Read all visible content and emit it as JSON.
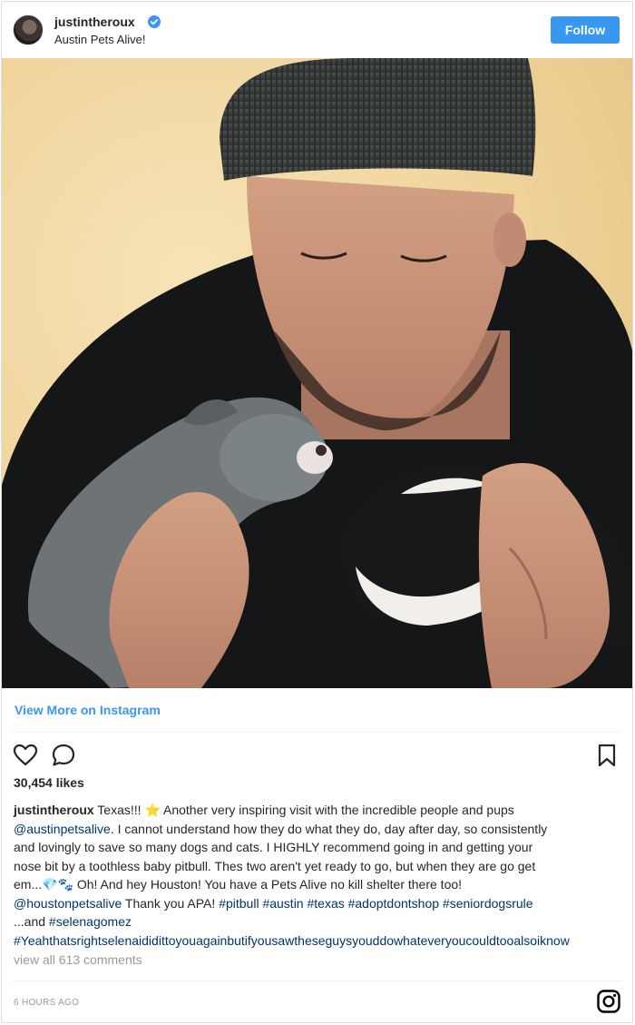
{
  "header": {
    "username": "justintheroux",
    "location": "Austin Pets Alive!",
    "follow_label": "Follow",
    "verified_icon": "verified-badge-icon",
    "accent_color": "#3897f0"
  },
  "post": {
    "view_more_label": "View More on Instagram",
    "likes": "30,454 likes",
    "caption": {
      "username": "justintheroux",
      "line1_text": " Texas!!! ⭐ Another very inspiring visit with the incredible people and pups",
      "line2_tag": "@austinpetsalive",
      "line2_text": ". I cannot understand how they do what they do, day after day, so consistently",
      "line3_text": "and lovingly to save so many dogs and cats. I HIGHLY recommend going in and getting your",
      "line4_text": "nose bit by a toothless baby pitbull. Thes two aren't yet ready to go, but when they are go get",
      "line5_text": "em...💎🐾 Oh! And hey Houston! You have a Pets Alive no kill shelter there too!",
      "line6_tag1": "@houstonpetsalive",
      "line6_text": " Thank you APA! ",
      "line6_tags": "#pitbull #austin #texas #adoptdontshop #seniordogsrule",
      "line7_text": "...and ",
      "line7_tag": "#selenagomez",
      "line8_tag": "#Yeahthatsrightselenaididittoyouagainbutifyousawtheseguysyouddowhateveryoucouldtooalsoiknow"
    },
    "comments_link": "view all 613 comments",
    "timestamp": "6 HOURS AGO"
  },
  "icons": {
    "like": "heart-icon",
    "comment": "comment-icon",
    "save": "bookmark-icon",
    "brand": "instagram-icon"
  }
}
